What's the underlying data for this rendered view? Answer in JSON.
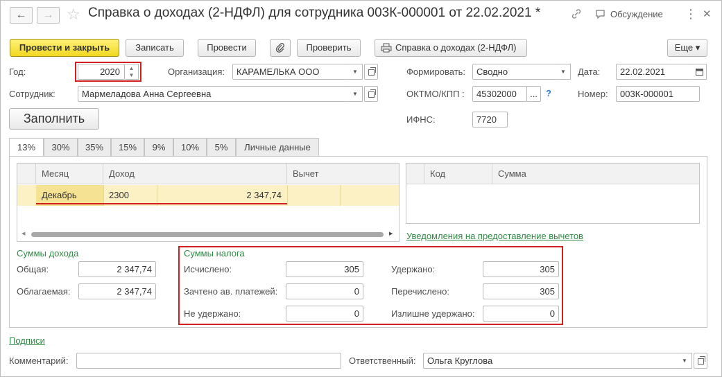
{
  "header": {
    "title": "Справка о доходах (2-НДФЛ) для сотрудника 003К-000001 от 22.02.2021 *",
    "back_icon": "←",
    "forward_icon": "→",
    "star_icon": "☆",
    "link_icon": "🔗",
    "discussion_label": "Обсуждение",
    "more_icon": "⋮",
    "close_icon": "✕"
  },
  "toolbar": {
    "post_close": "Провести и закрыть",
    "save": "Записать",
    "post": "Провести",
    "check": "Проверить",
    "print_report": "Справка о доходах (2-НДФЛ)",
    "more": "Еще ▾"
  },
  "form": {
    "year_label": "Год:",
    "year_value": "2020",
    "org_label": "Организация:",
    "org_value": "КАРАМЕЛЬКА ООО",
    "form_label": "Формировать:",
    "form_value": "Сводно",
    "date_label": "Дата:",
    "date_value": "22.02.2021",
    "employee_label": "Сотрудник:",
    "employee_value": "Мармеладова Анна Сергеевна",
    "oktmo_label": "ОКТМО/КПП :",
    "oktmo_value": "45302000",
    "oktmo_select": "...",
    "help_mark": "?",
    "number_label": "Номер:",
    "number_value": "003К-000001",
    "fill_button": "Заполнить",
    "ifns_label": "ИФНС:",
    "ifns_value": "7720"
  },
  "tabs": [
    "13%",
    "30%",
    "35%",
    "15%",
    "9%",
    "10%",
    "5%",
    "Личные данные"
  ],
  "income_table": {
    "headers": [
      "Месяц",
      "Доход",
      "Вычет"
    ],
    "rows": [
      {
        "month": "Декабрь",
        "code": "2300",
        "amount": "2 347,74",
        "deduction": ""
      }
    ]
  },
  "deduction_table": {
    "headers": [
      "Код",
      "Сумма"
    ]
  },
  "notifications_link": "Уведомления на предоставление вычетов",
  "income_sums": {
    "section_title": "Суммы дохода",
    "total_label": "Общая:",
    "total_value": "2 347,74",
    "taxable_label": "Облагаемая:",
    "taxable_value": "2 347,74"
  },
  "tax_sums": {
    "section_title": "Суммы налога",
    "calculated_label": "Исчислено:",
    "calculated_value": "305",
    "offset_label": "Зачтено ав. платежей:",
    "offset_value": "0",
    "not_withheld_label": "Не удержано:",
    "not_withheld_value": "0",
    "withheld_label": "Удержано:",
    "withheld_value": "305",
    "transferred_label": "Перечислено:",
    "transferred_value": "305",
    "overwithheld_label": "Излишне удержано:",
    "overwithheld_value": "0"
  },
  "footer": {
    "signatures_link": "Подписи",
    "comment_label": "Комментарий:",
    "comment_value": "",
    "responsible_label": "Ответственный:",
    "responsible_value": "Ольга Круглова"
  },
  "colors": {
    "accent_yellow": "#f3d81f",
    "highlight_red": "#d31f1f",
    "green_link": "#2f8a45",
    "selected_row": "#fbf1c4"
  }
}
